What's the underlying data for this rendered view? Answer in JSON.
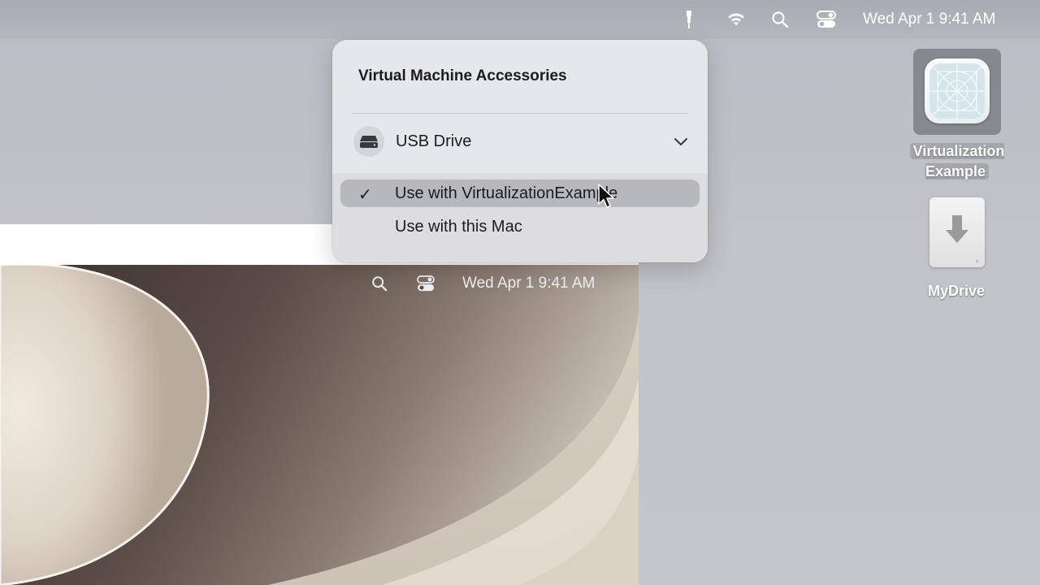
{
  "menubar": {
    "icons": [
      "usb-plug-icon",
      "wifi-icon",
      "search-icon",
      "control-center-icon"
    ],
    "clock": "Wed Apr 1  9:41 AM"
  },
  "desktop": {
    "items": [
      {
        "label": "Virtualization Example",
        "icon": "vm-app-icon",
        "selected": true
      },
      {
        "label": "MyDrive",
        "icon": "external-drive-icon"
      }
    ]
  },
  "vm_window": {
    "menubar": {
      "icons": [
        "search-icon",
        "control-center-icon"
      ],
      "clock": "Wed Apr 1  9:41 AM"
    }
  },
  "popover": {
    "title": "Virtual Machine Accessories",
    "device": {
      "label": "USB Drive",
      "icon": "drive-icon",
      "expanded": true
    },
    "options": [
      {
        "label": "Use with VirtualizationExample",
        "checked": true,
        "highlighted": true
      },
      {
        "label": "Use with this Mac",
        "checked": false
      }
    ],
    "check_glyph": "✓"
  }
}
